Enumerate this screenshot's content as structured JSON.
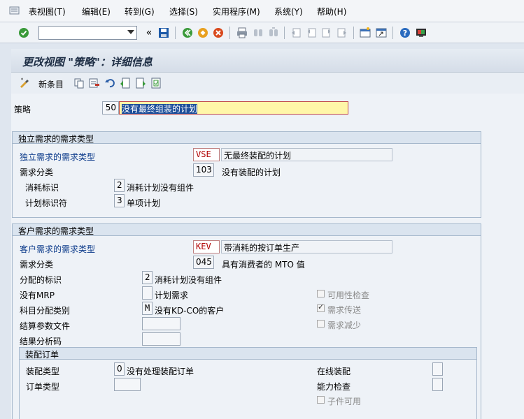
{
  "menu": [
    "表视图(T)",
    "编辑(E)",
    "转到(G)",
    "选择(S)",
    "实用程序(M)",
    "系统(Y)",
    "帮助(H)"
  ],
  "toolbar": {
    "command_value": "",
    "icons": [
      "enter-icon",
      "save-icon",
      "back-icon",
      "exit-icon",
      "cancel-icon",
      "print-icon",
      "find-icon",
      "find-next-icon",
      "first-page-icon",
      "previous-page-icon",
      "next-page-icon",
      "last-page-icon",
      "create-session-icon",
      "shortcut-icon",
      "help-icon",
      "layout-icon"
    ]
  },
  "title": "更改视图 \"策略\"：详细信息",
  "app_toolbar": {
    "new_entries_label": "新条目"
  },
  "strategy": {
    "label": "策略",
    "code": "50",
    "description": "没有最终组装的计划"
  },
  "independent_group": {
    "header": "独立需求的需求类型",
    "req_type_label": "独立需求的需求类型",
    "req_type_code": "VSE",
    "req_type_desc": "无最终装配的计划",
    "req_class_label": "需求分类",
    "req_class_code": "103",
    "req_class_desc": "没有装配的计划",
    "consumption_label": "消耗标识",
    "consumption_code": "2",
    "consumption_desc": "消耗计划没有组件",
    "planning_label": "计划标识符",
    "planning_code": "3",
    "planning_desc": "单项计划"
  },
  "customer_group": {
    "header": "客户需求的需求类型",
    "req_type_label": "客户需求的需求类型",
    "req_type_code": "KEV",
    "req_type_desc": "带消耗的按订单生产",
    "req_class_label": "需求分类",
    "req_class_code": "045",
    "req_class_desc": "具有消费者的 MTO 值",
    "allocation_label": "分配的标识",
    "allocation_code": "2",
    "allocation_desc": "消耗计划没有组件",
    "no_mrp_label": "没有MRP",
    "no_mrp_code": "",
    "no_mrp_desc": "计划需求",
    "acct_assign_label": "科目分配类别",
    "acct_assign_code": "M",
    "acct_assign_desc": "没有KD-CO的客户",
    "settlement_label": "结算参数文件",
    "result_analysis_label": "结果分析码",
    "availability_check_label": "可用性检查",
    "availability_check": false,
    "req_transfer_label": "需求传送",
    "req_transfer": true,
    "req_reduction_label": "需求减少",
    "req_reduction": false
  },
  "assembly_group": {
    "header": "装配订单",
    "assembly_type_label": "装配类型",
    "assembly_type_code": "0",
    "assembly_type_desc": "没有处理装配订单",
    "order_type_label": "订单类型",
    "online_assembly_label": "在线装配",
    "capacity_check_label": "能力检查",
    "components_avail_label": "子件可用",
    "components_avail": false
  }
}
